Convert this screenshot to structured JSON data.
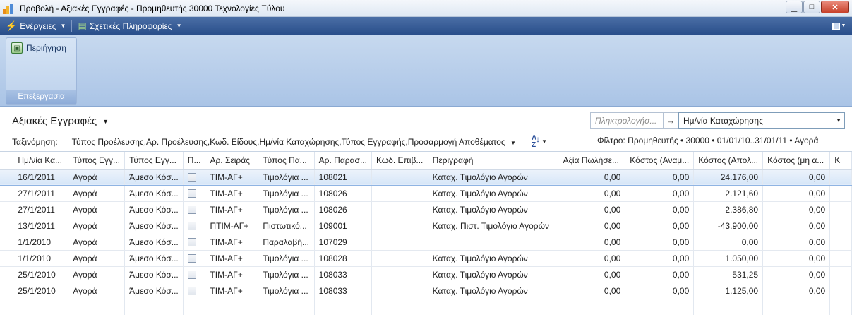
{
  "window": {
    "title": "Προβολή - Αξιακές Εγγραφές - Προμηθευτής 30000 Τεχνολογίες Ξύλου",
    "minimize": "▁",
    "maximize": "□",
    "close": "✕"
  },
  "menubar": {
    "actions_label": "Ενέργειες",
    "related_label": "Σχετικές Πληροφορίες"
  },
  "ribbon": {
    "preview_label": "Περιήγηση",
    "group_label": "Επεξεργασία"
  },
  "list": {
    "title": "Αξιακές Εγγραφές",
    "sort_prefix": "Ταξινόμηση:",
    "sort_value": "Τύπος Προέλευσης,Αρ. Προέλευσης,Κωδ. Είδους,Ημ/νία Καταχώρησης,Τύπος Εγγραφής,Προσαρμογή Αποθέματος",
    "search_placeholder": "Πληκτρολογήσ...",
    "field_select": "Ημ/νία Καταχώρησης",
    "filter_text": "Φίλτρο: Προμηθευτής • 30000 • 01/01/10..31/01/11 • Αγορά"
  },
  "columns": [
    "Ημ/νία Κα...",
    "Τύπος Εγγ...",
    "Τύπος Εγγ...",
    "Π...",
    "Αρ. Σειράς",
    "Τύπος Πα...",
    "Αρ. Παρασ...",
    "Κωδ. Επιβ...",
    "Περιγραφή",
    "Αξία Πωλήσε...",
    "Κόστος (Αναμ...",
    "Κόστος (Απολ...",
    "Κόστος (μη α...",
    "Κ"
  ],
  "rows": [
    {
      "date": "16/1/2011",
      "type": "Αγορά",
      "entry": "Άμεσο Κόσ...",
      "series": "ΤΙΜ-ΑΓ+",
      "doctype": "Τιμολόγια ...",
      "docno": "108021",
      "code": "",
      "desc": "Καταχ. Τιμολόγιο Αγορών",
      "sales": "0,00",
      "exp": "0,00",
      "actual": "24.176,00",
      "nonpost": "0,00"
    },
    {
      "date": "27/1/2011",
      "type": "Αγορά",
      "entry": "Άμεσο Κόσ...",
      "series": "ΤΙΜ-ΑΓ+",
      "doctype": "Τιμολόγια ...",
      "docno": "108026",
      "code": "",
      "desc": "Καταχ. Τιμολόγιο Αγορών",
      "sales": "0,00",
      "exp": "0,00",
      "actual": "2.121,60",
      "nonpost": "0,00"
    },
    {
      "date": "27/1/2011",
      "type": "Αγορά",
      "entry": "Άμεσο Κόσ...",
      "series": "ΤΙΜ-ΑΓ+",
      "doctype": "Τιμολόγια ...",
      "docno": "108026",
      "code": "",
      "desc": "Καταχ. Τιμολόγιο Αγορών",
      "sales": "0,00",
      "exp": "0,00",
      "actual": "2.386,80",
      "nonpost": "0,00"
    },
    {
      "date": "13/1/2011",
      "type": "Αγορά",
      "entry": "Άμεσο Κόσ...",
      "series": "ΠΤΙΜ-ΑΓ+",
      "doctype": "Πιστωτικό...",
      "docno": "109001",
      "code": "",
      "desc": "Καταχ. Πιστ. Τιμολόγιο Αγορών",
      "sales": "0,00",
      "exp": "0,00",
      "actual": "-43.900,00",
      "nonpost": "0,00"
    },
    {
      "date": "1/1/2010",
      "type": "Αγορά",
      "entry": "Άμεσο Κόσ...",
      "series": "ΤΙΜ-ΑΓ+",
      "doctype": "Παραλαβή...",
      "docno": "107029",
      "code": "",
      "desc": "",
      "sales": "0,00",
      "exp": "0,00",
      "actual": "0,00",
      "nonpost": "0,00"
    },
    {
      "date": "1/1/2010",
      "type": "Αγορά",
      "entry": "Άμεσο Κόσ...",
      "series": "ΤΙΜ-ΑΓ+",
      "doctype": "Τιμολόγια ...",
      "docno": "108028",
      "code": "",
      "desc": "Καταχ. Τιμολόγιο Αγορών",
      "sales": "0,00",
      "exp": "0,00",
      "actual": "1.050,00",
      "nonpost": "0,00"
    },
    {
      "date": "25/1/2010",
      "type": "Αγορά",
      "entry": "Άμεσο Κόσ...",
      "series": "ΤΙΜ-ΑΓ+",
      "doctype": "Τιμολόγια ...",
      "docno": "108033",
      "code": "",
      "desc": "Καταχ. Τιμολόγιο Αγορών",
      "sales": "0,00",
      "exp": "0,00",
      "actual": "531,25",
      "nonpost": "0,00"
    },
    {
      "date": "25/1/2010",
      "type": "Αγορά",
      "entry": "Άμεσο Κόσ...",
      "series": "ΤΙΜ-ΑΓ+",
      "doctype": "Τιμολόγια ...",
      "docno": "108033",
      "code": "",
      "desc": "Καταχ. Τιμολόγιο Αγορών",
      "sales": "0,00",
      "exp": "0,00",
      "actual": "1.125,00",
      "nonpost": "0,00"
    }
  ]
}
